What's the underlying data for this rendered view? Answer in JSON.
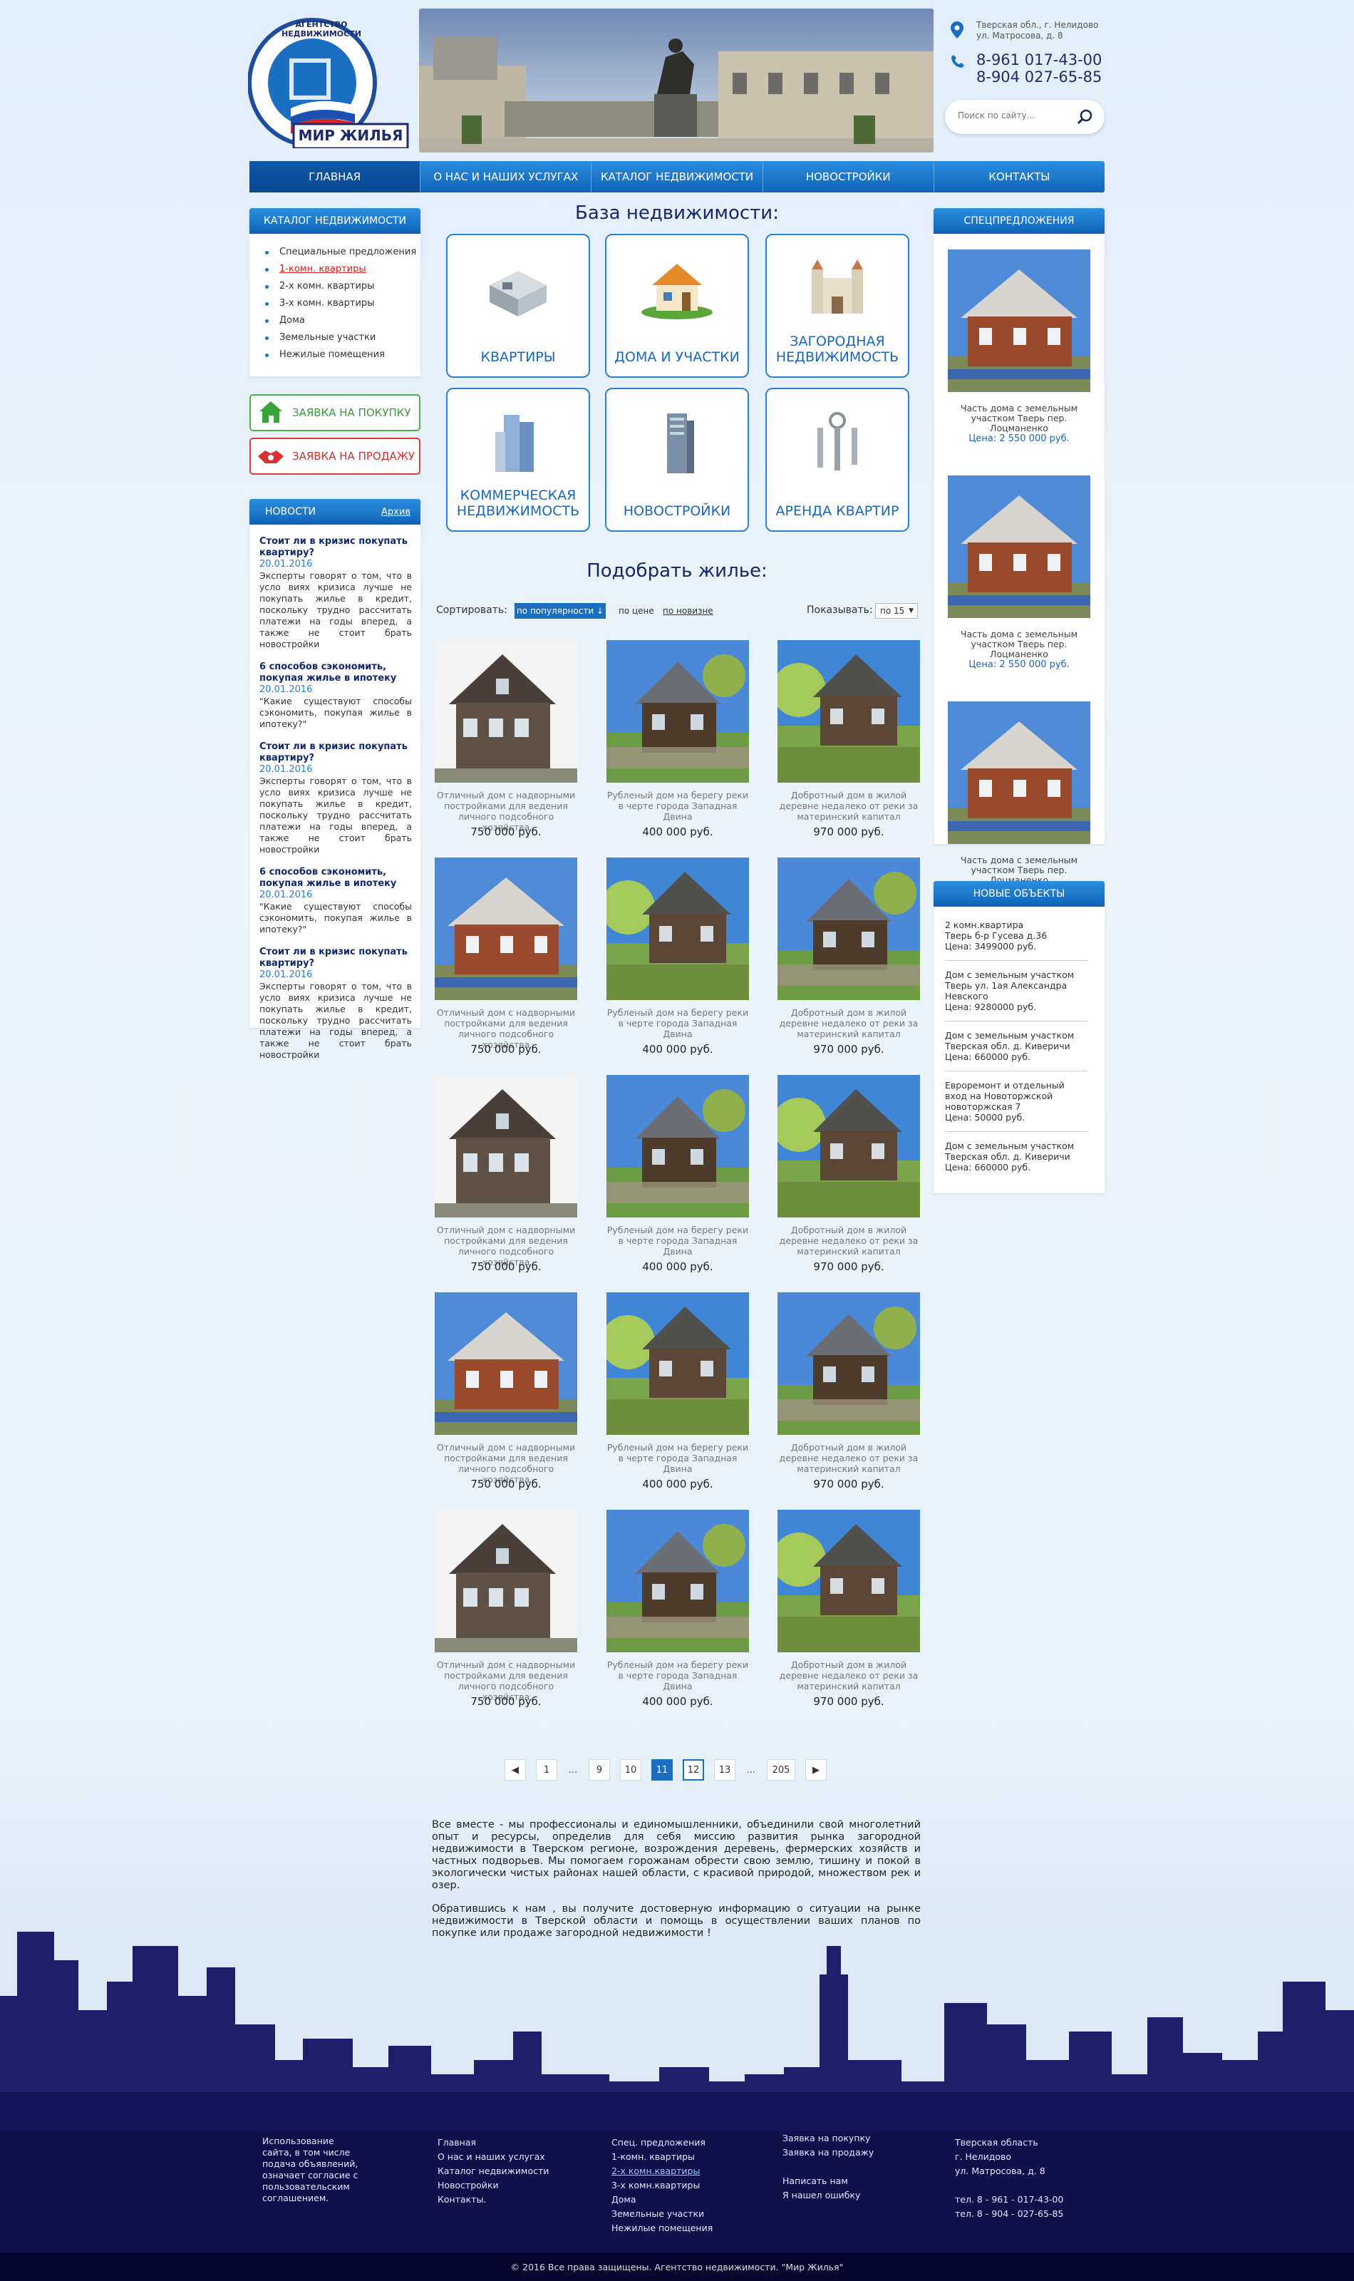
{
  "header": {
    "logo_top_text": "АГЕНТСТВО НЕДВИЖИМОСТИ",
    "logo_name": "МИР ЖИЛЬЯ",
    "address_line1": "Тверская обл., г. Нелидово",
    "address_line2": "ул. Матросова, д. 8",
    "phone1_prefix": "8-961",
    "phone1_number": "017-43-00",
    "phone2_prefix": "8-904",
    "phone2_number": "027-65-85",
    "search_placeholder": "Поиск по сайту..."
  },
  "nav": [
    "ГЛАВНАЯ",
    "О НАС И НАШИХ УСЛУГАХ",
    "КАТАЛОГ НЕДВИЖИМОСТИ",
    "НОВОСТРОЙКИ",
    "КОНТАКТЫ"
  ],
  "catalog": {
    "title": "КАТАЛОГ НЕДВИЖИМОСТИ",
    "items": [
      "Специальные предложения",
      "1-комн. квартиры",
      "2-х комн. квартиры",
      "3-х комн. квартиры",
      "Дома",
      "Земельные участки",
      "Нежилые помещения"
    ]
  },
  "requests": {
    "buy": "ЗАЯВКА НА ПОКУПКУ",
    "sell": "ЗАЯВКА НА ПРОДАЖУ"
  },
  "news": {
    "title": "НОВОСТИ",
    "archive": "Архив",
    "items": [
      {
        "title": "Стоит ли в кризис покупать квартиру?",
        "date": "20.01.2016",
        "text": "Эксперты говорят о том, что в усло виях кризиса лучше не покупать жилье в кредит, поскольку трудно рассчитать платежи на годы вперед, а также не стоит брать новостройки"
      },
      {
        "title": "6 способов сэкономить, покупая жилье в ипотеку",
        "date": "20.01.2016",
        "text": "\"Какие существуют способы сэкономить, покупая жилье в ипотеку?\""
      },
      {
        "title": "Стоит ли в кризис покупать квартиру?",
        "date": "20.01.2016",
        "text": "Эксперты говорят о том, что в усло виях кризиса лучше не покупать жилье в кредит, поскольку трудно рассчитать платежи на годы вперед, а также не стоит брать новостройки"
      },
      {
        "title": "6 способов сэкономить, покупая жилье в ипотеку",
        "date": "20.01.2016",
        "text": "\"Какие существуют способы сэкономить, покупая жилье в ипотеку?\""
      },
      {
        "title": "Стоит ли в кризис покупать квартиру?",
        "date": "20.01.2016",
        "text": "Эксперты говорят о том, что в усло виях кризиса лучше не покупать жилье в кредит, поскольку трудно рассчитать платежи на годы вперед, а также не стоит брать новостройки"
      }
    ]
  },
  "base": {
    "title": "База недвижимости:",
    "categories": [
      "КВАРТИРЫ",
      "ДОМА И УЧАСТКИ",
      "ЗАГОРОДНАЯ НЕДВИЖИМОСТЬ",
      "КОММЕРЧЕСКАЯ НЕДВИЖИМОСТЬ",
      "НОВОСТРОЙКИ",
      "АРЕНДА КВАРТИР"
    ]
  },
  "listing": {
    "title": "Подобрать жилье:",
    "sort_label": "Сортировать:",
    "sort_popular": "по популярности",
    "sort_price": "по цене",
    "sort_new": "по новизне",
    "show_label": "Показывать:",
    "show_value": "по 15",
    "items": [
      {
        "caption": "Отличный дом с надворными постройками для ведения личного подсобного хозяйства",
        "price": "750 000 руб."
      },
      {
        "caption": "Рубленый дом на берегу реки в черте города Западная Двина",
        "price": "400 000 руб."
      },
      {
        "caption": "Добротный дом в жилой деревне недалеко от реки за материнский капитал",
        "price": "970 000 руб."
      }
    ]
  },
  "pager": [
    "1",
    "...",
    "9",
    "10",
    "11",
    "12",
    "13",
    "...",
    "205"
  ],
  "about": {
    "p1": "Все вместе - мы профессионалы и единомышленники, объединили свой многолетний опыт и ресурсы, определив для себя миссию развития рынка загородной недвижимости в Тверском регионе, возрождения деревень, фермерских хозяйств и частных подворьев. Мы помогаем горожанам обрести свою землю, тишину и покой в экологически чистых районах нашей области, с красивой природой, множеством рек и озер.",
    "p2": "Обратившись к нам , вы получите достоверную информацию о ситуации на рынке недвижимости в Тверской области и помощь в осуществлении ваших  планов по покупке или продаже загородной недвижимости !"
  },
  "special": {
    "title": "СПЕЦПРЕДЛОЖЕНИЯ",
    "caption": "Часть дома с земельным участком Тверь пер. Лоцманенко",
    "price": "Цена: 2 550 000 руб."
  },
  "new_objects": {
    "title": "НОВЫЕ ОБЪЕКТЫ",
    "items": [
      "2 комн.квартира\nТверь б-р Гусева д.36\nЦена: 3499000 руб.",
      "Дом с земельным участком\nТверь ул. 1ая Александра Невского\nЦена: 9280000 руб.",
      "Дом с земельным участком\nТверская обл. д. Киверичи\nЦена: 660000 руб.",
      "Евроремонт и отдельный вход на Новоторжской\nновоторжская 7\nЦена: 50000 руб.",
      "Дом с земельным участком\nТверская обл. д. Киверичи\nЦена: 660000 руб."
    ]
  },
  "footer": {
    "terms": "Использование сайта, в том числе подача объявлений, означает согласие с пользовательским соглашением.",
    "col1": [
      "Главная",
      "О нас и наших услугах",
      "Каталог недвижимости",
      "Новостройки",
      "Контакты."
    ],
    "col2": [
      "Спец. предложения",
      "1-комн. квартиры",
      "2-х комн.квартиры",
      "3-х комн.квартиры",
      "Дома",
      "Земельные участки",
      "Нежилые помещения"
    ],
    "col3": [
      "Заявка на покупку",
      "Заявка на продажу",
      "",
      "Написать нам",
      "Я нашел ошибку"
    ],
    "col4": [
      "Тверская область",
      "г. Нелидово",
      "ул. Матросова, д. 8",
      "",
      "тел. 8 - 961 - 017-43-00",
      "тел. 8 - 904 - 027-65-85"
    ],
    "copyright": "© 2016 Все права защищены.  Агентство недвижимости. \"Мир Жилья\""
  }
}
